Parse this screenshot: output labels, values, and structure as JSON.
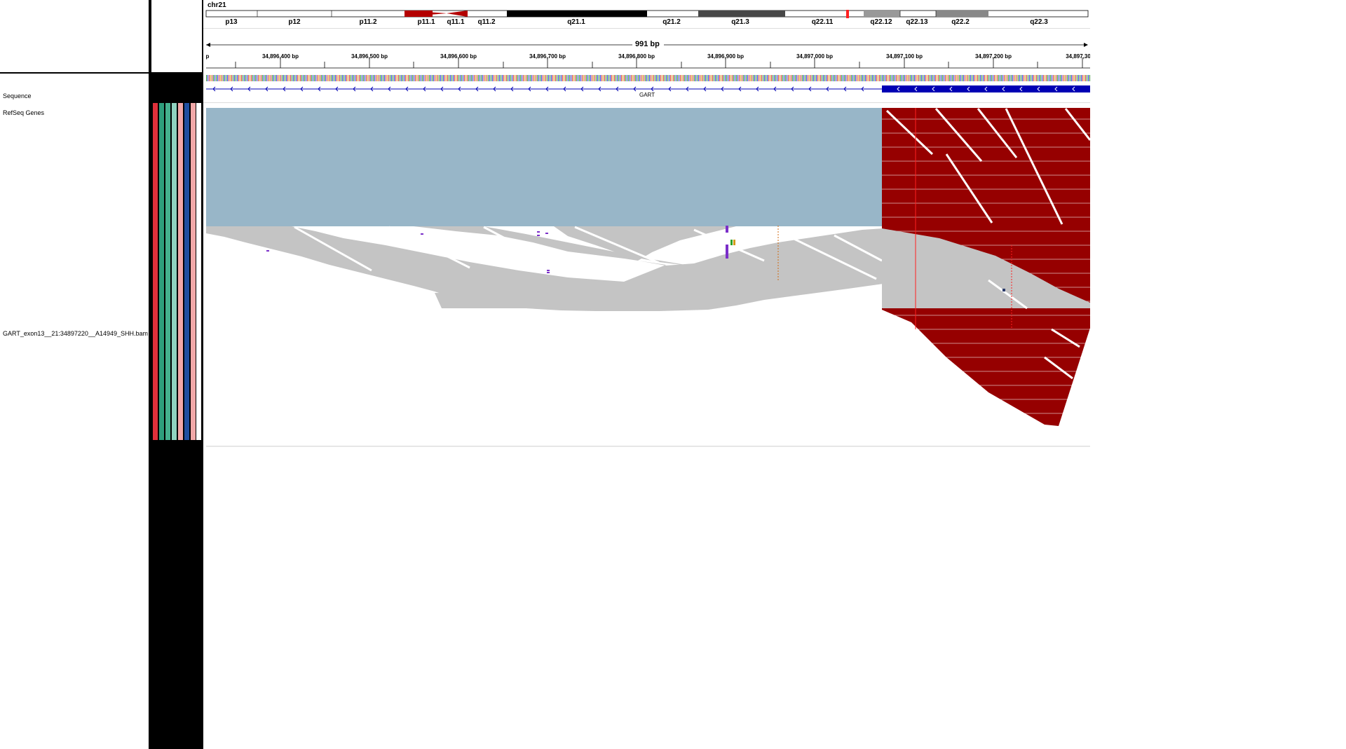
{
  "ideogram": {
    "chromosome": "chr21",
    "bands": [
      "p13",
      "p12",
      "p11.2",
      "p11.1",
      "q11.1",
      "q11.2",
      "q21.1",
      "q21.2",
      "q21.3",
      "q22.11",
      "q22.12",
      "q22.13",
      "q22.2",
      "q22.3"
    ]
  },
  "ruler": {
    "span_label": "991 bp",
    "left_cut_label": "p",
    "ticks": [
      "34,896,400 bp",
      "34,896,500 bp",
      "34,896,600 bp",
      "34,896,700 bp",
      "34,896,800 bp",
      "34,896,900 bp",
      "34,897,000 bp",
      "34,897,100 bp",
      "34,897,200 bp",
      "34,897,30"
    ]
  },
  "tracks": {
    "sequence": {
      "name": "Sequence",
      "strand_icon": "arrow-right-icon"
    },
    "refseq": {
      "name": "RefSeq Genes",
      "gene": "GART"
    },
    "alignment": {
      "name": "GART_exon13__21:34897220__A14949_SHH.bam"
    }
  },
  "colors": {
    "downsampled_block": "#98b6c8",
    "read_gray": "#c4c4c4",
    "read_red": "#960000",
    "gene_blue": "#0000b4",
    "centromere_red": "#b40000",
    "attr": [
      "#e0303a",
      "#2e9e7c",
      "#45b08e",
      "#8fd3c0",
      "#f1a8a8",
      "#f1a8a8",
      "#1f4fa0",
      "#ffffff"
    ]
  }
}
